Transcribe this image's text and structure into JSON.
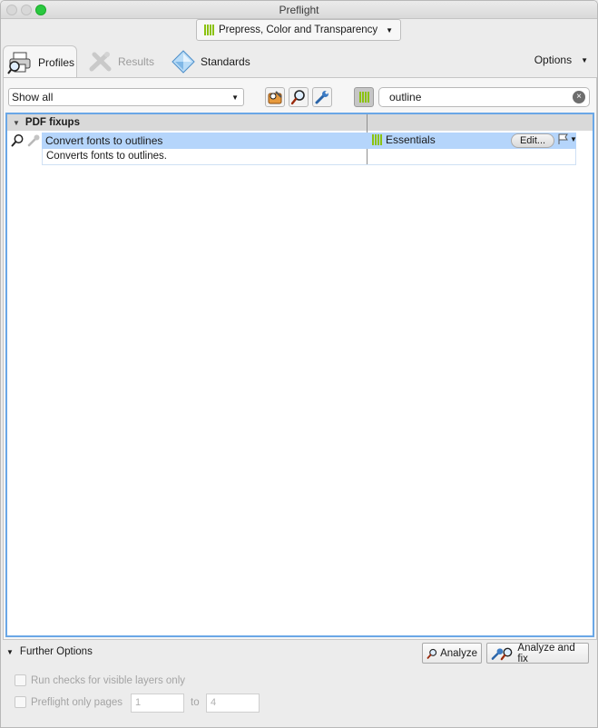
{
  "window": {
    "title": "Preflight"
  },
  "profile_selector": {
    "label": "Prepress, Color and Transparency"
  },
  "tabs": [
    {
      "label": "Profiles",
      "selected": true
    },
    {
      "label": "Results",
      "enabled": false
    },
    {
      "label": "Standards"
    }
  ],
  "options_menu": {
    "label": "Options"
  },
  "filter": {
    "value": "Show all"
  },
  "search": {
    "value": "outline"
  },
  "list": {
    "group": "PDF fixups",
    "rows": [
      {
        "name": "Convert fonts to outlines",
        "library": "Essentials",
        "edit_label": "Edit...",
        "description": "Converts fonts to outlines.",
        "selected": true
      }
    ]
  },
  "further_options": {
    "label": "Further Options"
  },
  "buttons": {
    "analyze": "Analyze",
    "analyze_fix": "Analyze and fix"
  },
  "settings": {
    "visible_layers_label": "Run checks for visible layers only",
    "pages_label": "Preflight only pages",
    "from_page": "1",
    "to_label": "to",
    "to_page": "4"
  },
  "colors": {
    "selection": "#b5d5fb",
    "focus_ring": "#6aa7e6",
    "essentials_green": "#8bc20f"
  }
}
